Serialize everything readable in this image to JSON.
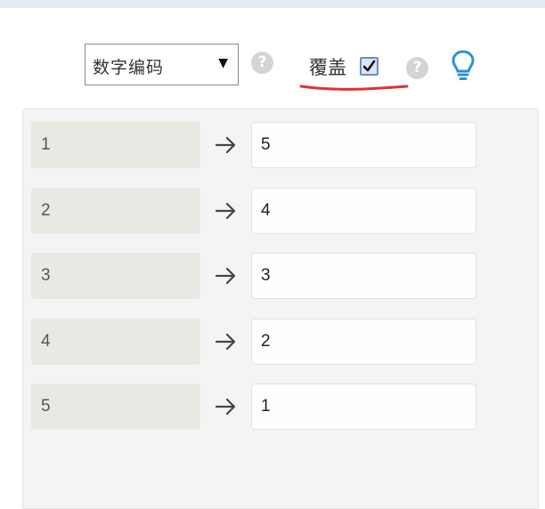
{
  "toolbar": {
    "mode_select": {
      "value": "数字编码"
    },
    "overwrite_label": "覆盖",
    "overwrite_checked": true,
    "help_glyph": "?",
    "icons": [
      "help-icon",
      "lightbulb-icon",
      "arrow-right-icon",
      "checkbox-check-icon"
    ],
    "accent_color": "#2b8fd6",
    "annotation_color": "#e03131"
  },
  "mapping": [
    {
      "from": "1",
      "to": "5"
    },
    {
      "from": "2",
      "to": "4"
    },
    {
      "from": "3",
      "to": "3"
    },
    {
      "from": "4",
      "to": "2"
    },
    {
      "from": "5",
      "to": "1"
    }
  ]
}
